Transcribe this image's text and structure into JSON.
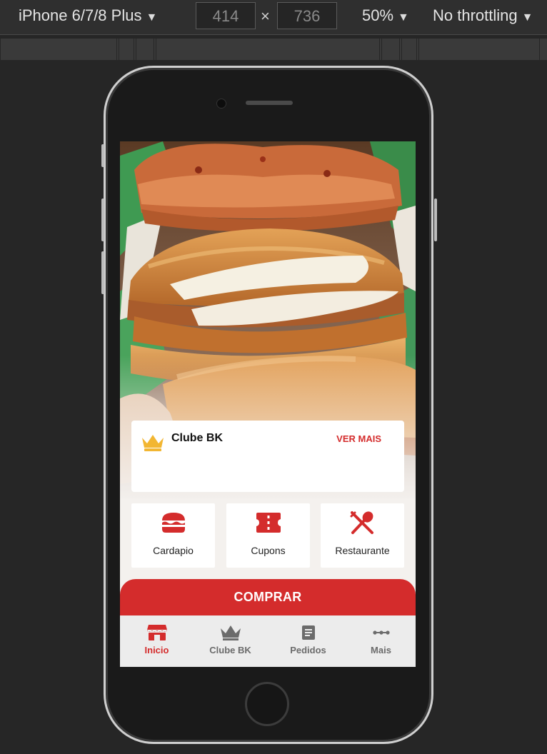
{
  "devtools": {
    "device": "iPhone 6/7/8 Plus",
    "width": "414",
    "height": "736",
    "times": "×",
    "zoom": "50%",
    "throttle": "No throttling",
    "caret": "▼"
  },
  "club": {
    "title": "Clube BK",
    "more": "VER MAIS"
  },
  "tiles": [
    {
      "label": "Cardapio",
      "icon": "burger-icon"
    },
    {
      "label": "Cupons",
      "icon": "ticket-icon"
    },
    {
      "label": "Restaurante",
      "icon": "utensils-icon"
    }
  ],
  "buy_button": "COMPRAR",
  "nav": [
    {
      "label": "Inicio",
      "icon": "store-icon",
      "active": true
    },
    {
      "label": "Clube BK",
      "icon": "crown-icon",
      "active": false
    },
    {
      "label": "Pedidos",
      "icon": "receipt-icon",
      "active": false
    },
    {
      "label": "Mais",
      "icon": "more-dots-icon",
      "active": false
    }
  ],
  "colors": {
    "brand_red": "#d42c2c",
    "crown_gold": "#f2b632",
    "nav_inactive": "#6b6b6b"
  }
}
